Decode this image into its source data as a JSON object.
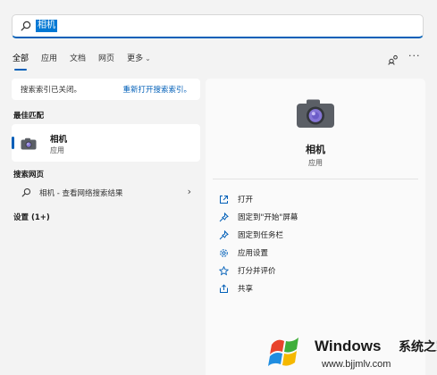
{
  "search": {
    "query": "相机"
  },
  "tabs": [
    "全部",
    "应用",
    "文档",
    "网页",
    "更多"
  ],
  "notice": {
    "message": "搜索索引已关闭。",
    "link": "重新打开搜索索引。"
  },
  "best_match": {
    "title": "最佳匹配",
    "name": "相机",
    "type": "应用"
  },
  "web_search": {
    "title": "搜索网页",
    "label": "相机 - 查看网络搜索结果"
  },
  "settings": {
    "title": "设置 (1+)"
  },
  "detail": {
    "name": "相机",
    "type": "应用",
    "actions": [
      "打开",
      "固定到\"开始\"屏幕",
      "固定到任务栏",
      "应用设置",
      "打分并评价",
      "共享"
    ]
  },
  "watermark": {
    "brand": "Windows",
    "cn": "系统之家",
    "url": "www.bjjmlv.com"
  },
  "colors": {
    "accent": "#005fb8",
    "highlight": "#0078d4"
  }
}
